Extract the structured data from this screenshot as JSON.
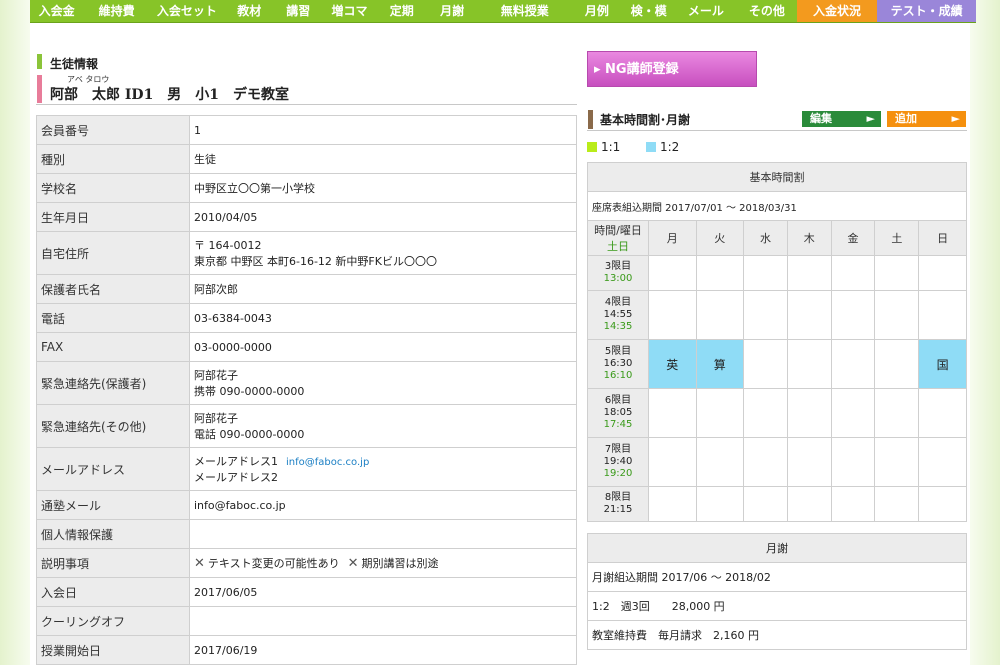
{
  "nav": {
    "tabs": [
      "入会金",
      "維持費",
      "入会セット",
      "教材",
      "講習",
      "増コマ",
      "定期",
      "月謝",
      "無料授業",
      "月例",
      "検・模",
      "メール",
      "その他",
      "入金状況",
      "テスト・成績"
    ]
  },
  "student": {
    "section_title": "生徒情報",
    "kana": "アベ タロウ",
    "name_line": "阿部　太郎 ID1　男　小1　デモ教室",
    "rows": [
      {
        "k": "会員番号",
        "v": [
          "1"
        ]
      },
      {
        "k": "種別",
        "v": [
          "生徒"
        ]
      },
      {
        "k": "学校名",
        "v": [
          "中野区立〇〇第一小学校"
        ]
      },
      {
        "k": "生年月日",
        "v": [
          "2010/04/05"
        ]
      },
      {
        "k": "自宅住所",
        "v": [
          "〒 164-0012",
          "東京都 中野区 本町6-16-12 新中野FKビル〇〇〇"
        ]
      },
      {
        "k": "保護者氏名",
        "v": [
          "阿部次郎"
        ]
      },
      {
        "k": "電話",
        "v": [
          "03-6384-0043"
        ]
      },
      {
        "k": "FAX",
        "v": [
          "03-0000-0000"
        ]
      },
      {
        "k": "緊急連絡先(保護者)",
        "v": [
          "阿部花子",
          "携帯 090-0000-0000"
        ]
      },
      {
        "k": "緊急連絡先(その他)",
        "v": [
          "阿部花子",
          "電話 090-0000-0000"
        ]
      },
      {
        "k": "メールアドレス",
        "v": [
          "メールアドレス1",
          "メールアドレス2"
        ],
        "email": "info@faboc.co.jp"
      },
      {
        "k": "通塾メール",
        "v": [
          "info@faboc.co.jp"
        ]
      },
      {
        "k": "個人情報保護",
        "v": [
          ""
        ]
      },
      {
        "k": "説明事項",
        "v": [
          ""
        ],
        "checks": [
          "テキスト変更の可能性あり",
          "期別講習は別途"
        ]
      },
      {
        "k": "入会日",
        "v": [
          "2017/06/05"
        ]
      },
      {
        "k": "クーリングオフ",
        "v": [
          ""
        ]
      },
      {
        "k": "授業開始日",
        "v": [
          "2017/06/19"
        ]
      }
    ]
  },
  "ng_button": "▸ NG講師登録",
  "schedule": {
    "section_title": "基本時間割･月謝",
    "edit_label": "編集",
    "add_label": "追加",
    "legend": [
      {
        "label": "1:1",
        "color": "#b9ec1a"
      },
      {
        "label": "1:2",
        "color": "#8fdcf6"
      }
    ],
    "table_title": "基本時間割",
    "period_text": "座席表組込期間 2017/07/01 ～ 2018/03/31",
    "corner_top": "時間/曜日",
    "corner_bottom": "土日",
    "days": [
      "月",
      "火",
      "水",
      "木",
      "金",
      "土",
      "日"
    ],
    "periods": [
      {
        "name": "3限目",
        "t1": "13:00",
        "t2": ""
      },
      {
        "name": "4限目",
        "t1": "14:55",
        "t2": "14:35"
      },
      {
        "name": "5限目",
        "t1": "16:30",
        "t2": "16:10"
      },
      {
        "name": "6限目",
        "t1": "18:05",
        "t2": "17:45"
      },
      {
        "name": "7限目",
        "t1": "19:40",
        "t2": "19:20"
      },
      {
        "name": "8限目",
        "t1": "21:15",
        "t2": ""
      }
    ],
    "classes": {
      "2-0": "英",
      "2-1": "算",
      "2-6": "国"
    }
  },
  "fee": {
    "title": "月謝",
    "period": "月謝組込期間 2017/06 ～ 2018/02",
    "plan": "1:2　週3回　　28,000 円",
    "maint": "教室維持費　毎月請求　2,160 円"
  }
}
